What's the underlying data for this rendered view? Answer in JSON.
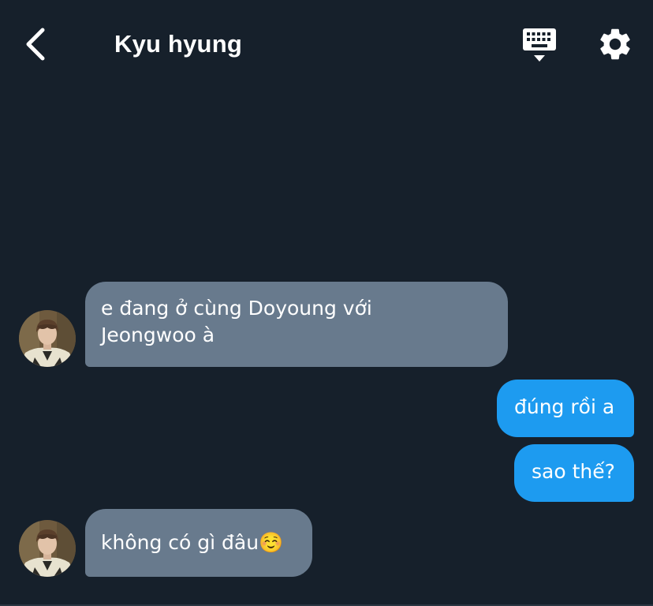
{
  "header": {
    "title": "Kyu hyung",
    "back_icon": "chevron-left-icon",
    "keyboard_icon": "keyboard-icon",
    "settings_icon": "gear-icon"
  },
  "messages": [
    {
      "direction": "received",
      "text_line1": "e đang ở cùng Doyoung với",
      "text_line2": "Jeongwoo à"
    },
    {
      "direction": "sent",
      "text": "đúng rồi a"
    },
    {
      "direction": "sent",
      "text": "sao thế?"
    },
    {
      "direction": "received",
      "text": "không có gì đâu☺️"
    }
  ],
  "colors": {
    "background": "#16202b",
    "received_bubble": "#687a8d",
    "sent_bubble": "#1d9bf0",
    "text": "#ffffff"
  }
}
